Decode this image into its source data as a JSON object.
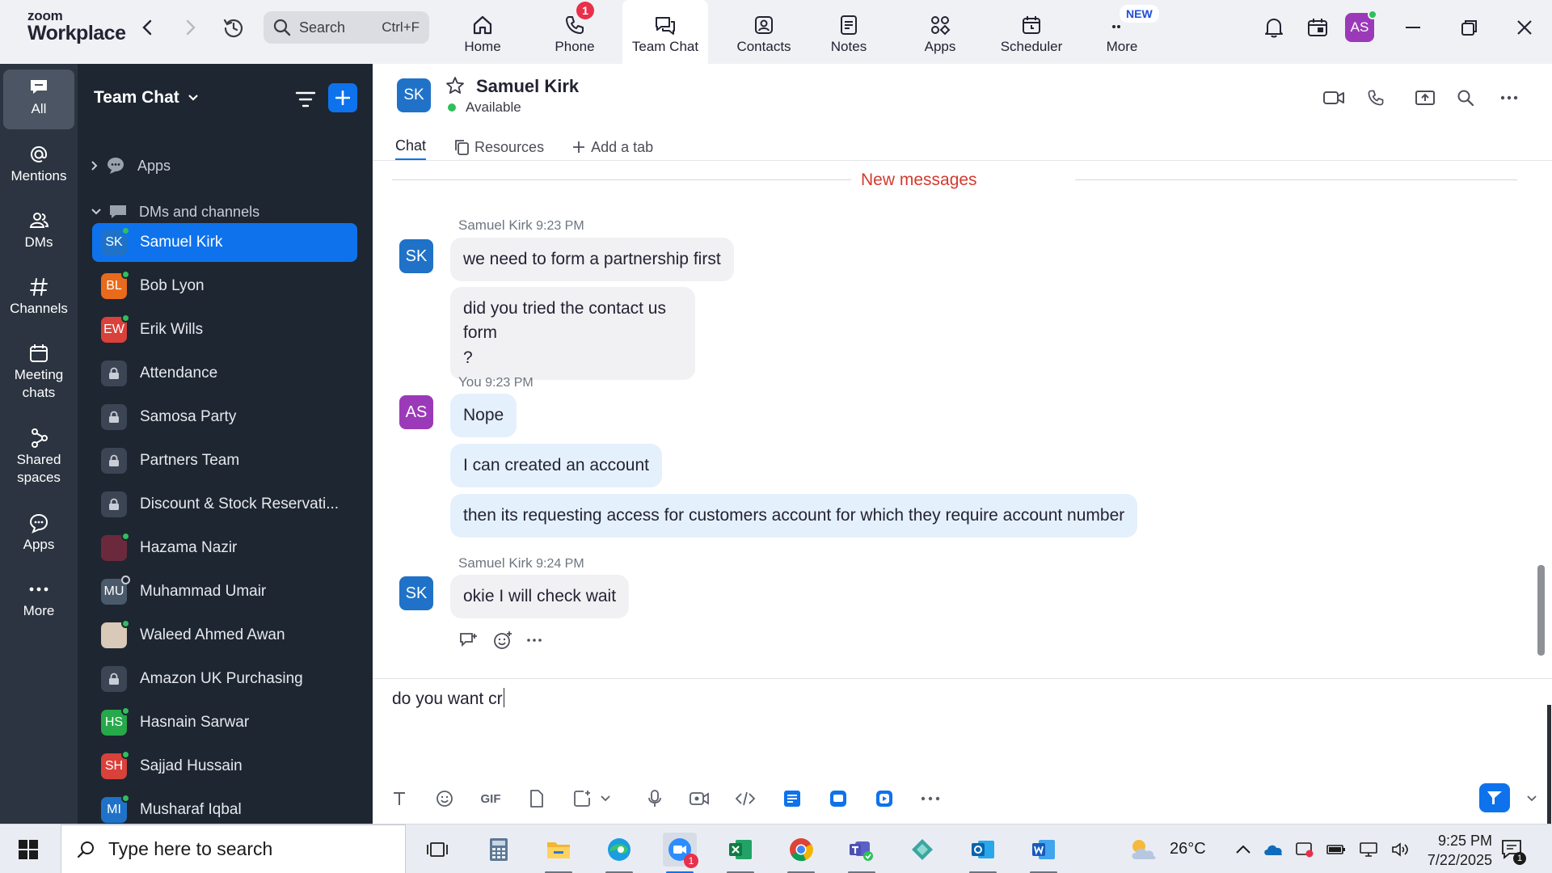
{
  "window": {
    "logo_line1": "zoom",
    "logo_line2": "Workplace"
  },
  "topbar": {
    "search_label": "Search",
    "search_shortcut": "Ctrl+F",
    "tabs": [
      {
        "label": "Home",
        "icon": "home-icon"
      },
      {
        "label": "Phone",
        "icon": "phone-icon",
        "badge": "1"
      },
      {
        "label": "Team Chat",
        "icon": "chat-icon",
        "active": true
      },
      {
        "label": "Contacts",
        "icon": "contacts-icon"
      },
      {
        "label": "Notes",
        "icon": "notes-icon"
      },
      {
        "label": "Apps",
        "icon": "apps-icon"
      },
      {
        "label": "Scheduler",
        "icon": "scheduler-icon"
      },
      {
        "label": "More",
        "icon": "more-icon"
      }
    ],
    "new_badge": "NEW",
    "avatar_initials": "AS"
  },
  "rail": {
    "items": [
      {
        "label": "All",
        "icon": "chat-bubble-icon",
        "active": true
      },
      {
        "label": "Mentions",
        "icon": "at-icon"
      },
      {
        "label": "DMs",
        "icon": "people-icon"
      },
      {
        "label": "Channels",
        "icon": "hash-icon"
      },
      {
        "label": "Meeting chats",
        "icon": "calendar-icon"
      },
      {
        "label": "Shared spaces",
        "icon": "shared-spaces-icon"
      },
      {
        "label": "Apps",
        "icon": "apps-chat-icon"
      },
      {
        "label": "More",
        "icon": "ellipsis-icon"
      }
    ]
  },
  "sidebar": {
    "title": "Team Chat",
    "section_apps": "Apps",
    "section_dms": "DMs and channels",
    "items": [
      {
        "label": "Samuel Kirk",
        "initials": "SK",
        "color": "#1f72c7",
        "status": "online",
        "active": true
      },
      {
        "label": "Bob Lyon",
        "initials": "BL",
        "color": "#e86a1c",
        "status": "online"
      },
      {
        "label": "Erik Wills",
        "initials": "EW",
        "color": "#d9413b",
        "status": "online"
      },
      {
        "label": "Attendance",
        "initials": "",
        "color": "#3b4553",
        "status": "lock"
      },
      {
        "label": "Samosa Party",
        "initials": "",
        "color": "#3b4553",
        "status": "lock"
      },
      {
        "label": "Partners Team",
        "initials": "",
        "color": "#3b4553",
        "status": "lock"
      },
      {
        "label": "Discount & Stock Reservati...",
        "initials": "",
        "color": "#3b4553",
        "status": "lock"
      },
      {
        "label": "Hazama Nazir",
        "initials": "",
        "color": "#6b2a3c",
        "status": "online"
      },
      {
        "label": "Muhammad Umair",
        "initials": "MU",
        "color": "#4b5a6b",
        "status": "offline"
      },
      {
        "label": "Waleed Ahmed Awan",
        "initials": "",
        "color": "#d8c9b8",
        "status": "online"
      },
      {
        "label": "Amazon UK Purchasing",
        "initials": "",
        "color": "#3b4553",
        "status": "lock"
      },
      {
        "label": "Hasnain Sarwar",
        "initials": "HS",
        "color": "#27a84a",
        "status": "online"
      },
      {
        "label": "Sajjad Hussain",
        "initials": "SH",
        "color": "#d9413b",
        "status": "online"
      },
      {
        "label": "Musharaf Iqbal",
        "initials": "MI",
        "color": "#1f72c7",
        "status": "online"
      }
    ]
  },
  "chat": {
    "contact_initials": "SK",
    "contact_name": "Samuel Kirk",
    "contact_status": "Available",
    "tabs": [
      "Chat",
      "Resources",
      "Add a tab"
    ],
    "new_messages_label": "New messages",
    "groups": [
      {
        "sender": "Samuel Kirk",
        "time": "9:23 PM",
        "initials": "SK",
        "messages": [
          "we need to form a partnership first",
          "did you tried the contact us form",
          "?"
        ]
      },
      {
        "sender": "You",
        "time": "9:23 PM",
        "initials": "AS",
        "messages": [
          "Nope",
          "I can created an account",
          "then its requesting access for customers account for which they require account number"
        ]
      },
      {
        "sender": "Samuel Kirk",
        "time": "9:24 PM",
        "initials": "SK",
        "messages": [
          "okie I will check wait"
        ]
      }
    ],
    "composer_text": "do you want cr"
  },
  "taskbar": {
    "search_placeholder": "Type here to search",
    "temperature": "26°C",
    "time": "9:25 PM",
    "date": "7/22/2025",
    "zoom_badge": "1",
    "notification_count": "1"
  },
  "colors": {
    "accent": "#0e72ed",
    "sidebar_bg": "#1e2631",
    "rail_bg": "#2b3440",
    "new_messages": "#d33a2f"
  }
}
